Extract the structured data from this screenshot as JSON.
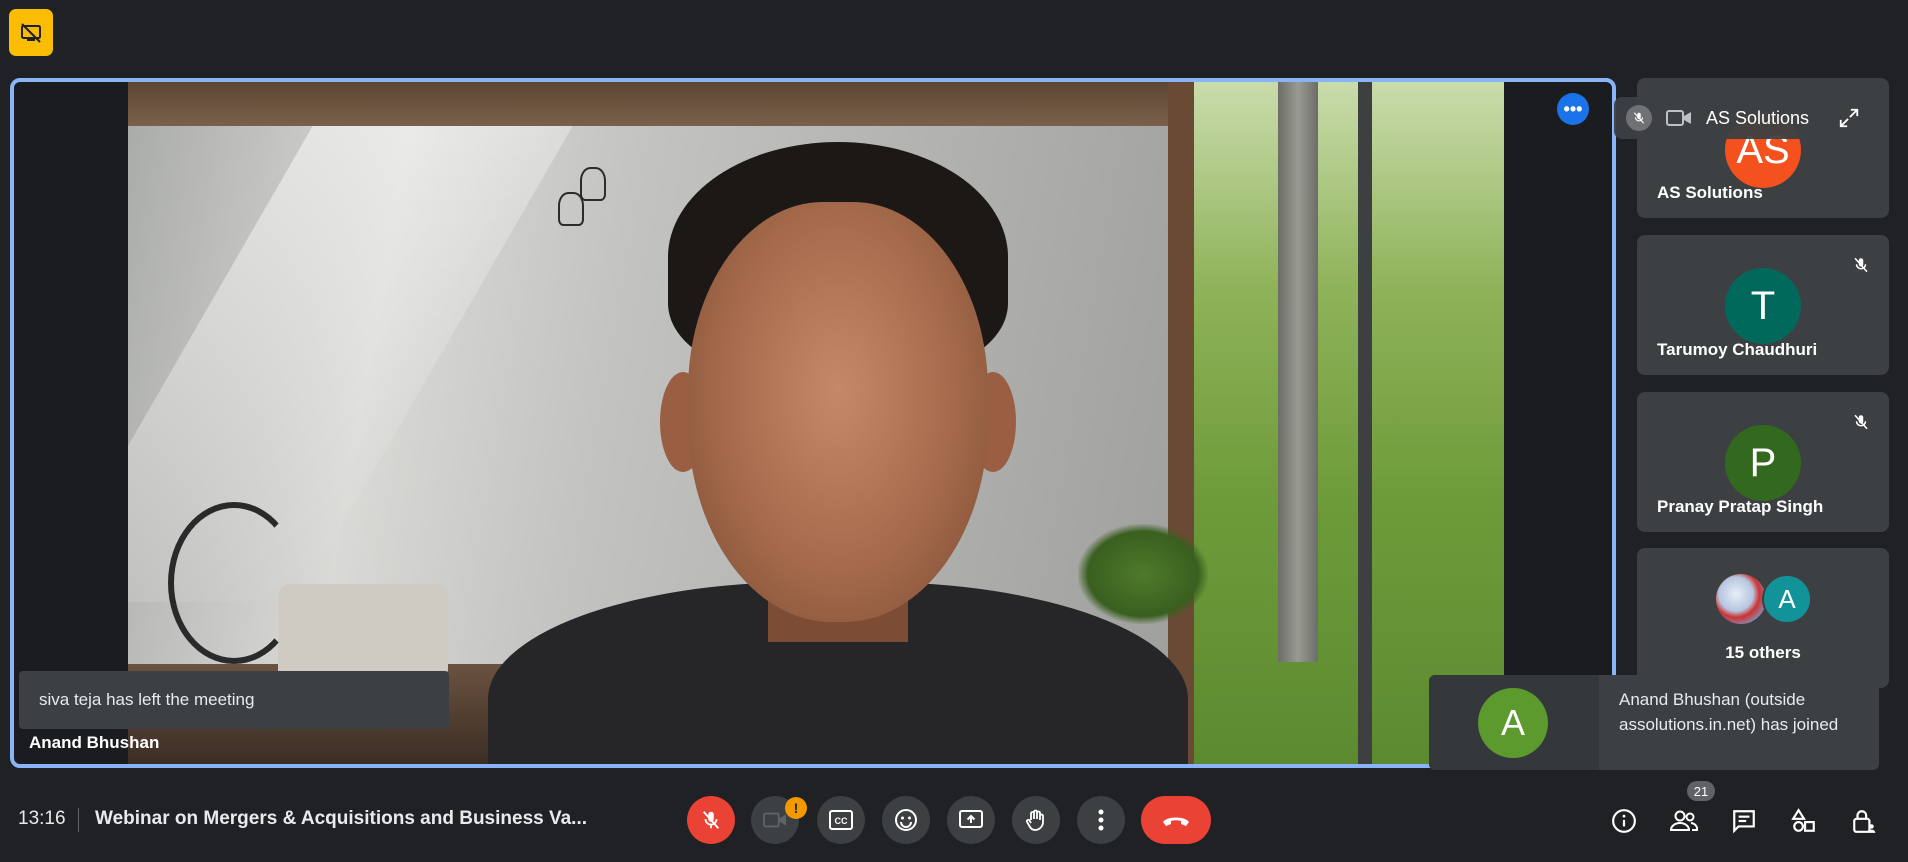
{
  "meeting": {
    "time": "13:16",
    "title": "Webinar on Mergers & Acquisitions and Business Va..."
  },
  "stage": {
    "speaker_name": "Anand Bhushan",
    "notification": "siva teja has left the meeting"
  },
  "pinned_overlay": {
    "label": "AS Solutions"
  },
  "tiles": [
    {
      "initials": "AS",
      "name": "AS Solutions",
      "color": "#f4511e"
    },
    {
      "initials": "T",
      "name": "Tarumoy Chaudhuri",
      "color": "#00695c"
    },
    {
      "initials": "P",
      "name": "Pranay Pratap Singh",
      "color": "#33691e"
    }
  ],
  "others": {
    "initial": "A",
    "label": "15 others"
  },
  "join_toast": {
    "initial": "A",
    "message": "Anand Bhushan (outside assolutions.in.net) has joined"
  },
  "controls": {
    "camera_alert": "!",
    "participants_count": "21"
  },
  "colors": {
    "accent": "#8ab4f8",
    "end_call": "#ea4335",
    "badge": "#fbbc04"
  }
}
